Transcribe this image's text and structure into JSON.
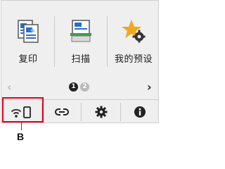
{
  "apps": [
    {
      "label": "复印",
      "icon": "copy-icon"
    },
    {
      "label": "扫描",
      "icon": "scan-icon"
    },
    {
      "label": "我的预设",
      "icon": "my-presets-icon"
    }
  ],
  "pager": {
    "left_arrow": "‹",
    "right_arrow": "›",
    "pages": [
      "1",
      "2"
    ],
    "current_page": "1"
  },
  "bottom_bar": [
    {
      "icon": "wireless-direct-icon"
    },
    {
      "icon": "link-icon"
    },
    {
      "icon": "settings-gear-icon"
    },
    {
      "icon": "info-icon"
    }
  ],
  "callout": {
    "label": "B"
  },
  "colors": {
    "highlight": "#e6001a",
    "star": "#f0a81e",
    "screen_bg": "#efefef"
  }
}
